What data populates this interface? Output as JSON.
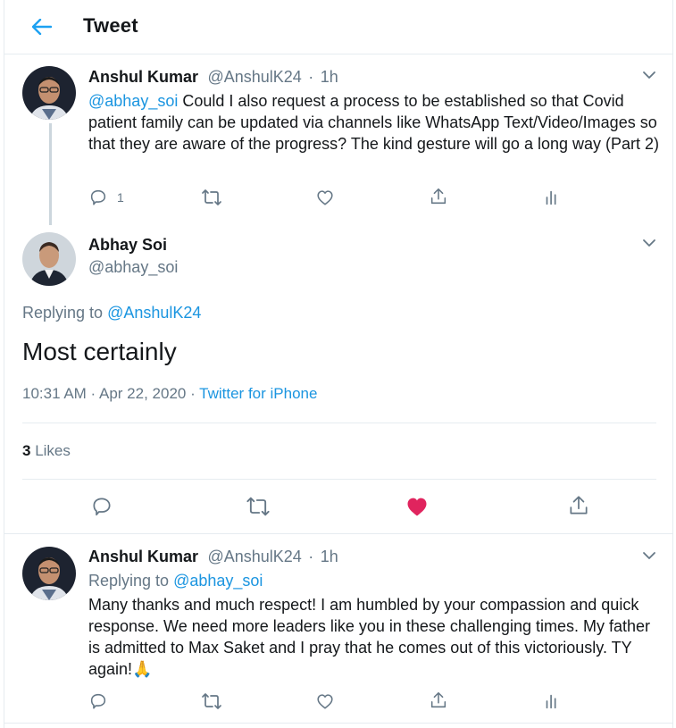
{
  "header": {
    "title": "Tweet"
  },
  "tweet1": {
    "name": "Anshul Kumar",
    "handle": "@AnshulK24",
    "sep": "·",
    "time": "1h",
    "mention": "@abhay_soi",
    "text": " Could I also request a process to be established so that Covid patient family can be updated via channels like WhatsApp Text/Video/Images so that they are aware of the progress? The kind gesture will go a long way (Part 2)",
    "reply_count": "1"
  },
  "main": {
    "name": "Abhay Soi",
    "handle": "@abhay_soi",
    "replying_prefix": "Replying to ",
    "replying_to": "@AnshulK24",
    "text": "Most certainly",
    "timestamp": "10:31 AM · Apr 22, 2020 · ",
    "source": "Twitter for iPhone",
    "likes_count": "3",
    "likes_label": " Likes",
    "like_color": "#e0245e"
  },
  "reply": {
    "name": "Anshul Kumar",
    "handle": "@AnshulK24",
    "sep": "·",
    "time": "1h",
    "replying_prefix": "Replying to ",
    "replying_to": "@abhay_soi",
    "text": "Many thanks and much respect! I am humbled by your compassion and quick response. We need more leaders like you in these challenging times. My father is admitted to Max Saket and I pray that he comes out of this victoriously. TY again!",
    "emoji": "🙏"
  },
  "icons": [
    "back-arrow",
    "chevron-down",
    "reply",
    "retweet",
    "like",
    "share",
    "analytics",
    "pray-emoji"
  ]
}
